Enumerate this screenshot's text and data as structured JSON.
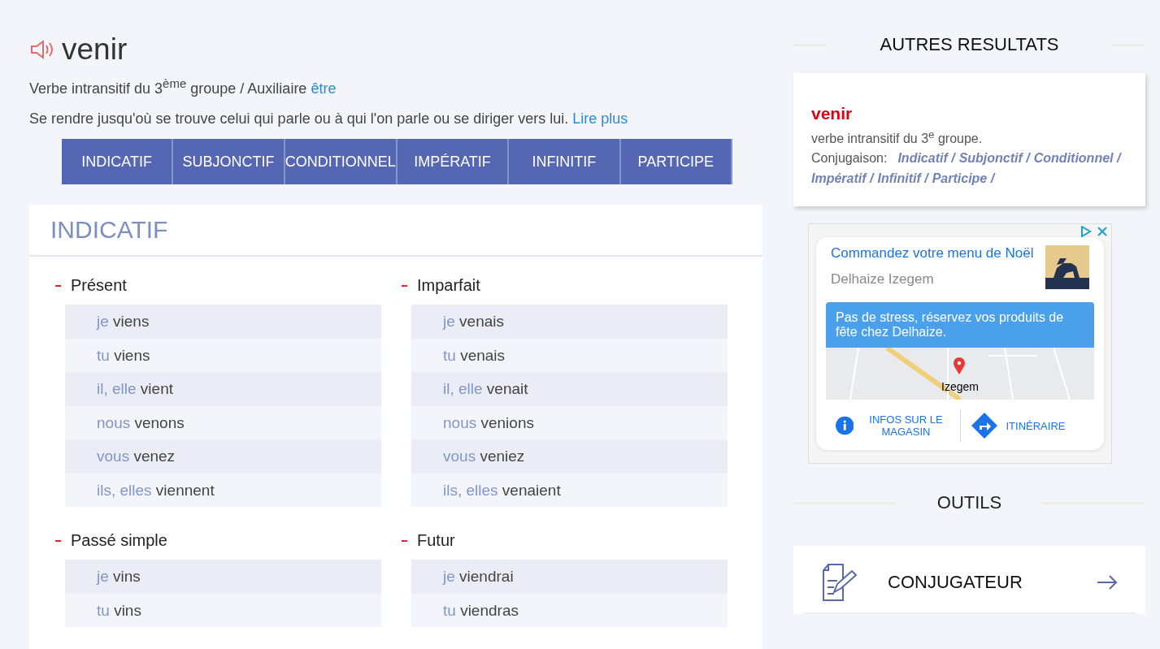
{
  "verb": {
    "title": "venir",
    "subtitle": "Verbe intransitif du 3$^{ème}$ groupe / Auxiliaire ",
    "auxiliary_link": "être",
    "definition": "Se rendre jusqu'où se trouve celui qui parle ou à qui l'on parle ou se diriger vers lui.",
    "read_more": "Lire plus"
  },
  "tabs": [
    "INDICATIF",
    "SUBJONCTIF",
    "CONDITIONNEL",
    "IMPÉRATIF",
    "INFINITIF",
    "PARTICIPE"
  ],
  "mood": {
    "title": "INDICATIF",
    "tenses": [
      {
        "title": "Présent",
        "rows": [
          {
            "pronoun": "je",
            "verb": "viens"
          },
          {
            "pronoun": "tu",
            "verb": "viens"
          },
          {
            "pronoun": "il, elle",
            "verb": "vient"
          },
          {
            "pronoun": "nous",
            "verb": "venons"
          },
          {
            "pronoun": "vous",
            "verb": "venez"
          },
          {
            "pronoun": "ils, elles",
            "verb": "viennent"
          }
        ]
      },
      {
        "title": "Imparfait",
        "rows": [
          {
            "pronoun": "je",
            "verb": "venais"
          },
          {
            "pronoun": "tu",
            "verb": "venais"
          },
          {
            "pronoun": "il, elle",
            "verb": "venait"
          },
          {
            "pronoun": "nous",
            "verb": "venions"
          },
          {
            "pronoun": "vous",
            "verb": "veniez"
          },
          {
            "pronoun": "ils, elles",
            "verb": "venaient"
          }
        ]
      },
      {
        "title": "Passé simple",
        "rows": [
          {
            "pronoun": "je",
            "verb": "vins"
          },
          {
            "pronoun": "tu",
            "verb": "vins"
          }
        ]
      },
      {
        "title": "Futur",
        "rows": [
          {
            "pronoun": "je",
            "verb": "viendrai"
          },
          {
            "pronoun": "tu",
            "verb": "viendras"
          }
        ]
      }
    ]
  },
  "other_results": {
    "heading": "AUTRES RESULTATS",
    "word": "venir",
    "description": "verbe intransitif du 3$^{e}$ groupe.",
    "conjugation_label": "Conjugaison:",
    "links": [
      "Indicatif /",
      "Subjonctif /",
      "Conditionnel /",
      "Impératif /",
      "Infinitif /",
      "Participe /"
    ]
  },
  "ad": {
    "title": "Commandez votre menu de Noël",
    "advertiser": "Delhaize Izegem",
    "banner": "Pas de stress, réservez vos produits de fête chez Delhaize.",
    "map_label": "Izegem",
    "actions": [
      "INFOS SUR LE MAGASIN",
      "ITINÉRAIRE"
    ]
  },
  "tools": {
    "heading": "OUTILS",
    "items": [
      "CONJUGATEUR"
    ]
  }
}
